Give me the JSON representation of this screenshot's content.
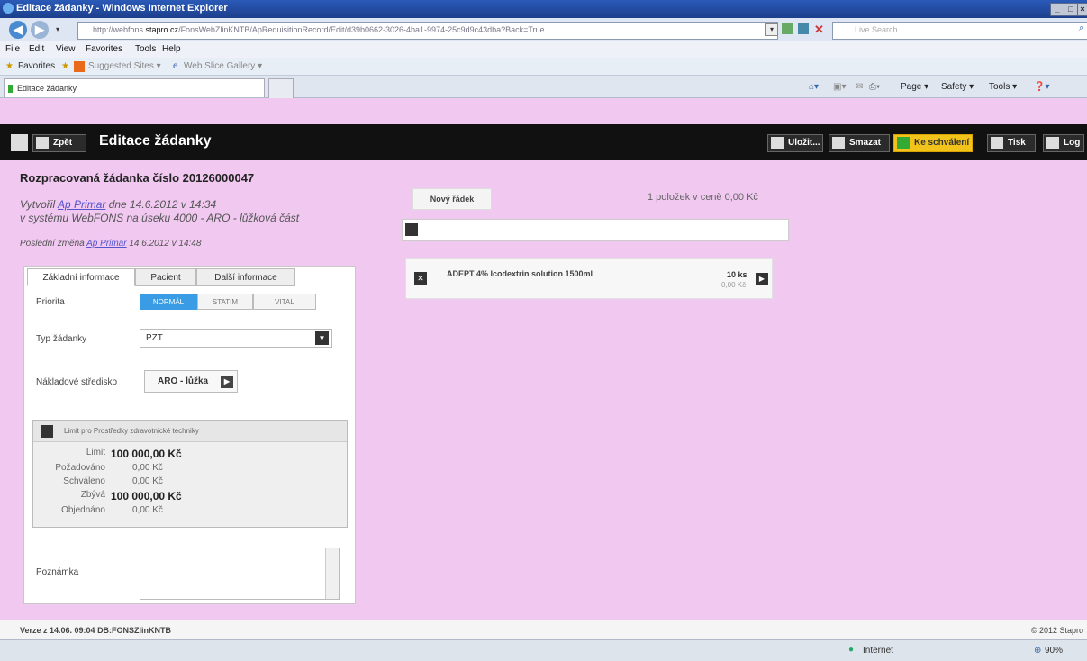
{
  "window": {
    "title": "Editace žádanky - Windows Internet Explorer"
  },
  "browser": {
    "url_prefix": "http://webfons.",
    "url_host": "stapro.cz",
    "url_rest": "/FonsWebZlinKNTB/ApRequisitionRecord/Edit/d39b0662-3026-4ba1-9974-25c9d9c43dba?Back=True",
    "search_placeholder": "Live Search",
    "menu": [
      "File",
      "Edit",
      "View",
      "Favorites",
      "Tools",
      "Help"
    ],
    "favorites_label": "Favorites",
    "suggested_sites": "Suggested Sites ▾",
    "web_slice_gallery": "Web Slice Gallery ▾",
    "tab_title": "Editace žádanky",
    "commands": [
      "Page ▾",
      "Safety ▾",
      "Tools ▾"
    ],
    "status_zone": "Internet",
    "zoom": "90%"
  },
  "app": {
    "back_label": "Zpět",
    "title": "Editace žádanky",
    "toolbar": {
      "save": "Uložit...",
      "delete": "Smazat",
      "approve": "Ke schválení",
      "print": "Tisk",
      "log": "Log"
    }
  },
  "info": {
    "heading": "Rozpracovaná žádanka číslo 20126000047",
    "created_prefix": "Vytvořil ",
    "created_user": "Ap Primar",
    "created_suffix": " dne 14.6.2012 v 14:34",
    "system_line": "v systému WebFONS na úseku 4000 - ARO - lůžková část",
    "changed_prefix": "Poslední změna ",
    "changed_user": "Ap Primar",
    "changed_suffix": " 14.6.2012 v 14:48"
  },
  "tabs": [
    "Základní informace",
    "Pacient",
    "Další informace"
  ],
  "form": {
    "priority_label": "Priorita",
    "priority_options": [
      "NORMÁL",
      "STATIM",
      "VITAL"
    ],
    "priority_selected": "NORMÁL",
    "type_label": "Typ žádanky",
    "type_value": "PZT",
    "cost_center_label": "Nákladové středisko",
    "cost_center_value": "ARO - lůžka",
    "note_label": "Poznámka",
    "note_value": ""
  },
  "limit": {
    "header": "Limit pro Prostředky zdravotnické techniky",
    "rows": [
      {
        "key": "Limit",
        "value": "100 000,00 Kč"
      },
      {
        "key": "Požadováno",
        "value": "0,00 Kč"
      },
      {
        "key": "Schváleno",
        "value": "0,00 Kč"
      },
      {
        "key": "Zbývá",
        "value": "100 000,00 Kč"
      },
      {
        "key": "Objednáno",
        "value": "0,00 Kč"
      }
    ]
  },
  "items": {
    "new_row_label": "Nový řádek",
    "summary": "1 položek v ceně 0,00 Kč",
    "search_value": "",
    "list": [
      {
        "name": "ADEPT 4% Icodextrin solution 1500ml",
        "qty": "10 ks",
        "price": "0,00 Kč"
      }
    ]
  },
  "footer": {
    "version": "Verze z 14.06. 09:04 DB:FONSZlinKNTB",
    "copyright": "© 2012 Stapro"
  },
  "colors": {
    "background": "#f0c8f0",
    "header": "#111111",
    "accent_selected": "#3a9ce4",
    "approve_button": "#f2c31a"
  }
}
